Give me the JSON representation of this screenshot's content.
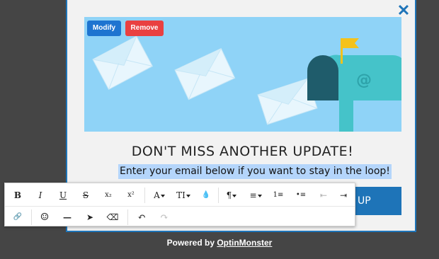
{
  "popup": {
    "close_glyph": "✕",
    "modify_label": "Modify",
    "remove_label": "Remove",
    "headline": "DON'T MISS ANOTHER UPDATE!",
    "subtext": "Enter your email below if you want to stay in the loop!",
    "cta_partial": "UP",
    "colors": {
      "accent": "#1e74b8",
      "hero_bg": "#8fd3f7",
      "remove": "#e94041",
      "mailbox": "#45c3c9"
    }
  },
  "footer": {
    "prefix": "Powered by",
    "brand": "OptinMonster"
  },
  "toolbar": {
    "row1": [
      {
        "name": "bold-button",
        "glyph": "B"
      },
      {
        "name": "italic-button",
        "glyph": "I"
      },
      {
        "name": "underline-button",
        "glyph": "U"
      },
      {
        "name": "strikethrough-button",
        "glyph": "S"
      },
      {
        "name": "subscript-button",
        "glyph": "x₂"
      },
      {
        "name": "superscript-button",
        "glyph": "x²"
      },
      {
        "name": "font-family-dropdown",
        "glyph": "A"
      },
      {
        "name": "font-size-dropdown",
        "glyph": "TI"
      },
      {
        "name": "text-color-button",
        "glyph": "💧"
      },
      {
        "name": "paragraph-format-dropdown",
        "glyph": "¶"
      },
      {
        "name": "align-dropdown",
        "glyph": "≡"
      },
      {
        "name": "ordered-list-button",
        "glyph": "1≡"
      },
      {
        "name": "unordered-list-button",
        "glyph": "•≡"
      },
      {
        "name": "outdent-button",
        "glyph": "⇤"
      },
      {
        "name": "indent-button",
        "glyph": "⇥"
      }
    ],
    "row2": [
      {
        "name": "link-button",
        "glyph": "🔗"
      },
      {
        "name": "emoticon-button",
        "glyph": "☺"
      },
      {
        "name": "horizontal-line-button",
        "glyph": "—"
      },
      {
        "name": "select-all-button",
        "glyph": "➤"
      },
      {
        "name": "clear-format-button",
        "glyph": "⌫"
      },
      {
        "name": "undo-button",
        "glyph": "↶"
      },
      {
        "name": "redo-button",
        "glyph": "↷"
      }
    ]
  }
}
